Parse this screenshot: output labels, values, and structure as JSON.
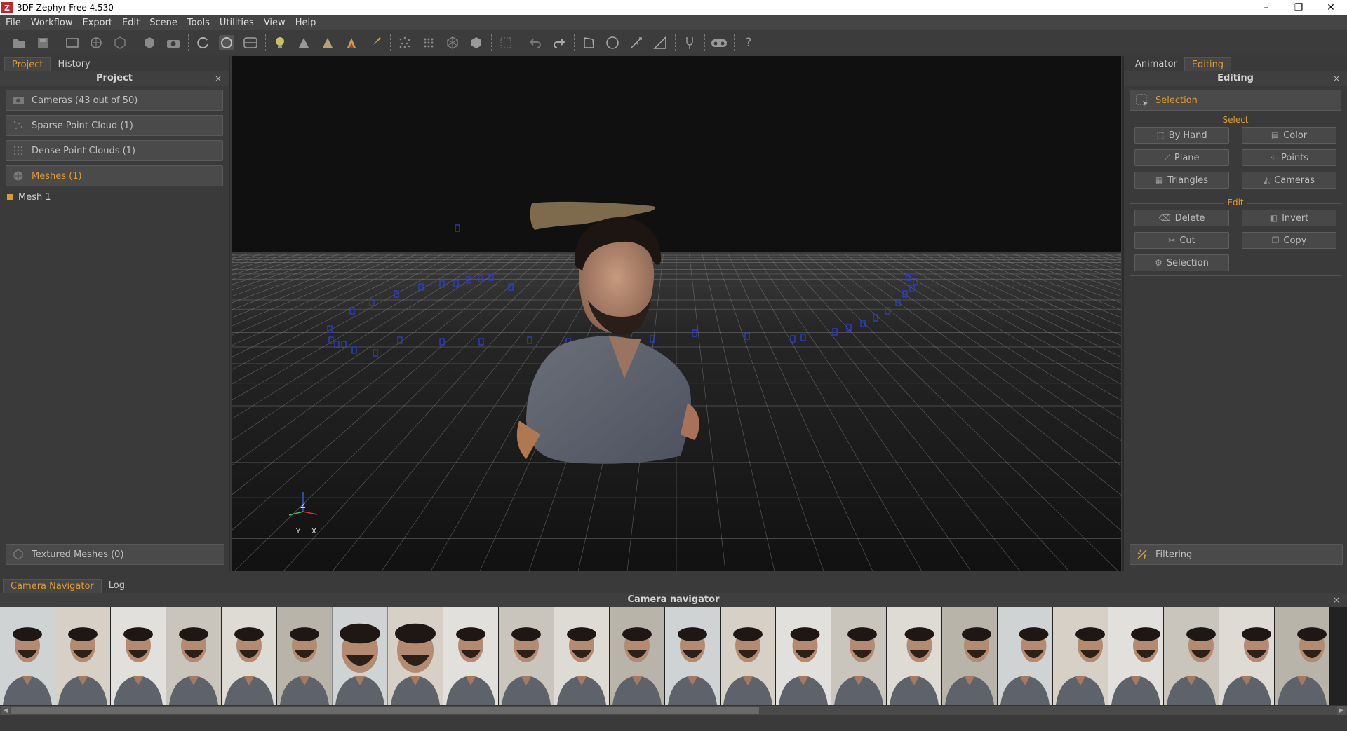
{
  "window": {
    "title": "3DF Zephyr Free 4.530",
    "app_icon_letter": "Z",
    "minimize": "–",
    "restore": "❐",
    "close": "✕"
  },
  "menu": [
    "File",
    "Workflow",
    "Export",
    "Edit",
    "Scene",
    "Tools",
    "Utilities",
    "View",
    "Help"
  ],
  "left_panel": {
    "tabs": [
      {
        "label": "Project",
        "active": true
      },
      {
        "label": "History",
        "active": false
      }
    ],
    "header": "Project",
    "close": "×",
    "sections": [
      {
        "label": "Cameras (43 out of 50)",
        "icon": "camera-icon",
        "active": false
      },
      {
        "label": "Sparse Point Cloud (1)",
        "icon": "sparse-cloud-icon",
        "active": false
      },
      {
        "label": "Dense Point Clouds (1)",
        "icon": "dense-cloud-icon",
        "active": false
      },
      {
        "label": "Meshes (1)",
        "icon": "mesh-icon",
        "active": true
      }
    ],
    "mesh_items": [
      {
        "label": "Mesh 1",
        "color": "#e09a2a"
      }
    ],
    "textured_meshes": "Textured Meshes (0)"
  },
  "viewport": {
    "axes": {
      "z": "Z",
      "y": "Y",
      "x": "X"
    }
  },
  "right_panel": {
    "tabs": [
      {
        "label": "Animator",
        "active": false
      },
      {
        "label": "Editing",
        "active": true
      }
    ],
    "header": "Editing",
    "close": "×",
    "selection_section": "Selection",
    "select_group": {
      "title": "Select",
      "buttons": [
        "By Hand",
        "Color",
        "Plane",
        "Points",
        "Triangles",
        "Cameras"
      ]
    },
    "edit_group": {
      "title": "Edit",
      "buttons": [
        "Delete",
        "Invert",
        "Cut",
        "Copy",
        "Selection"
      ]
    },
    "filtering_section": "Filtering"
  },
  "bottom": {
    "tabs": [
      {
        "label": "Camera Navigator",
        "active": true
      },
      {
        "label": "Log",
        "active": false
      }
    ],
    "header": "Camera navigator",
    "close": "×",
    "thumbnail_count": 24
  },
  "colors": {
    "accent": "#e09a2a",
    "camera_marker": "#2a3fd8",
    "grid": "#8a8a8a"
  }
}
